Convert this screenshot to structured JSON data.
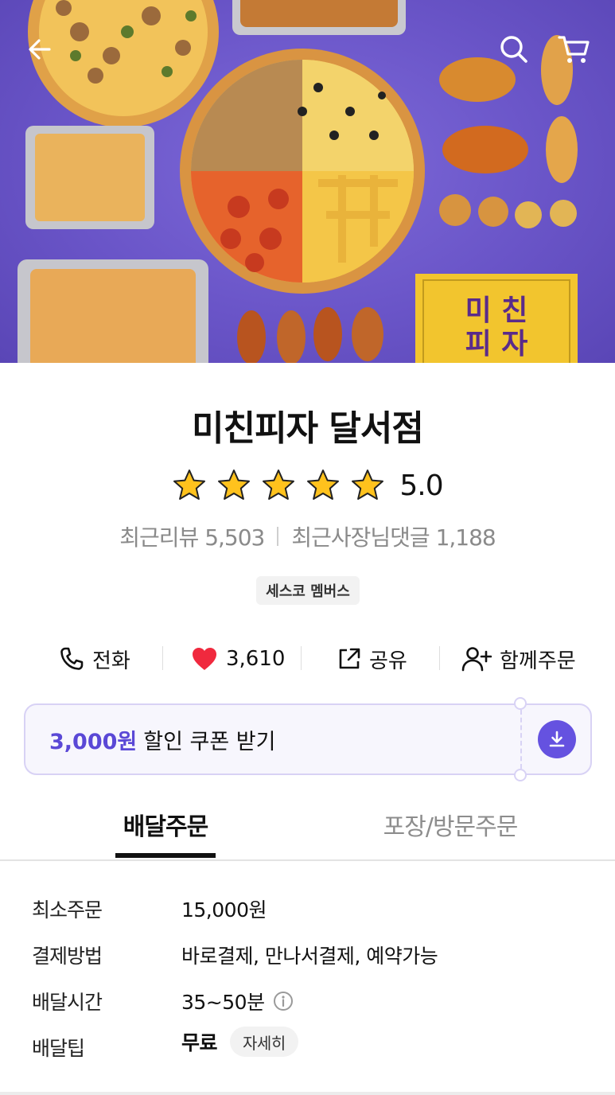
{
  "header": {
    "back_icon": "arrow-left-icon",
    "search_icon": "search-icon",
    "cart_icon": "cart-icon",
    "hero_box_text": "미친\n피자"
  },
  "store": {
    "name": "미친피자 달서점",
    "rating": "5.0",
    "rating_stars": 5,
    "recent_reviews_label": "최근리뷰 5,503",
    "owner_replies_label": "최근사장님댓글 1,188",
    "badge": "세스코 멤버스"
  },
  "actions": {
    "call": "전화",
    "likes": "3,610",
    "share": "공유",
    "group_order": "함께주문"
  },
  "coupon": {
    "amount": "3,000원",
    "label": "할인 쿠폰 받기",
    "accent": "#5a48d6"
  },
  "tabs": {
    "delivery": "배달주문",
    "pickup": "포장/방문주문"
  },
  "info": {
    "min_order_label": "최소주문",
    "min_order_value": "15,000원",
    "payment_label": "결제방법",
    "payment_value": "바로결제, 만나서결제, 예약가능",
    "delivery_time_label": "배달시간",
    "delivery_time_value": "35~50분",
    "delivery_tip_label": "배달팁",
    "delivery_tip_value": "무료",
    "detail_button": "자세히"
  }
}
